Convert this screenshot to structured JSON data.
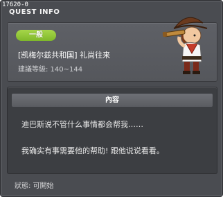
{
  "window": {
    "quest_id": "17620-0",
    "title": "QUEST INFO"
  },
  "info": {
    "category_badge": "一般",
    "quest_name": "[凯梅尔兹共和国] 礼尚往来",
    "level_range": "建議等級: 140~144"
  },
  "content": {
    "header": "內容",
    "line1": "迪巴斯说不管什么事情都会帮我……",
    "line2": "我确实有事需要他的帮助! 跟他说说看看。"
  },
  "status": {
    "text": "狀態: 可開始"
  },
  "colors": {
    "badge_green": "#8cc63a",
    "panel_bg": "#4a4c51"
  },
  "icons": {
    "npc": "npc-pirate-avatar-icon"
  }
}
